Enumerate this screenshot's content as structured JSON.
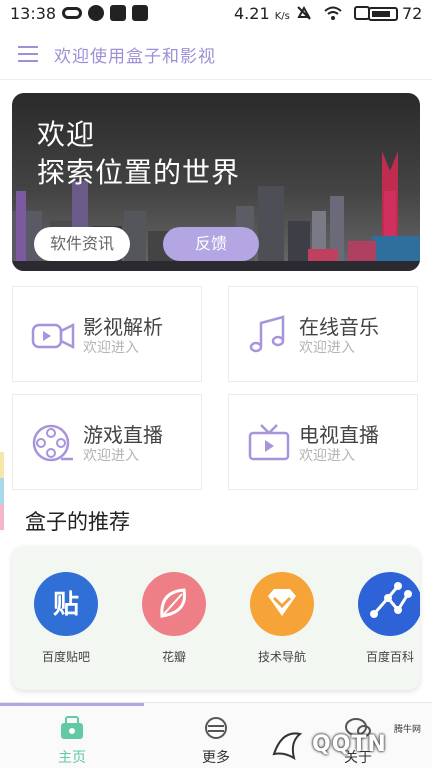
{
  "status_bar": {
    "time": "13:38",
    "net_speed": "4.21",
    "net_speed_unit": "K/s",
    "battery": "72"
  },
  "header": {
    "title": "欢迎使用盒子和影视"
  },
  "banner": {
    "line1": "欢迎",
    "line2": "探索位置的世界",
    "news_button": "软件资讯",
    "feedback_button": "反馈"
  },
  "features": [
    {
      "title": "影视解析",
      "subtitle": "欢迎进入",
      "icon": "video-camera-icon"
    },
    {
      "title": "在线音乐",
      "subtitle": "欢迎进入",
      "icon": "music-note-icon"
    },
    {
      "title": "游戏直播",
      "subtitle": "欢迎进入",
      "icon": "film-reel-icon"
    },
    {
      "title": "电视直播",
      "subtitle": "欢迎进入",
      "icon": "tv-icon"
    }
  ],
  "recommend": {
    "title": "盒子的推荐",
    "items": [
      {
        "label": "百度贴吧",
        "icon_text": "贴",
        "color": "#2f6fd6"
      },
      {
        "label": "花瓣",
        "icon_text": "",
        "color": "#ef7f86"
      },
      {
        "label": "技术导航",
        "icon_text": "",
        "color": "#f6a338"
      },
      {
        "label": "百度百科",
        "icon_text": "",
        "color": "#2e63d8"
      }
    ]
  },
  "bottom_nav": {
    "items": [
      {
        "label": "主页",
        "active": true
      },
      {
        "label": "更多",
        "active": false
      },
      {
        "label": "关于",
        "active": false
      }
    ]
  },
  "watermark": {
    "text": "QQTN",
    "small": "腾牛网"
  },
  "colors": {
    "accent": "#9e8fd6",
    "accent_light": "#b3a6e2",
    "active_nav": "#62c9a3"
  }
}
